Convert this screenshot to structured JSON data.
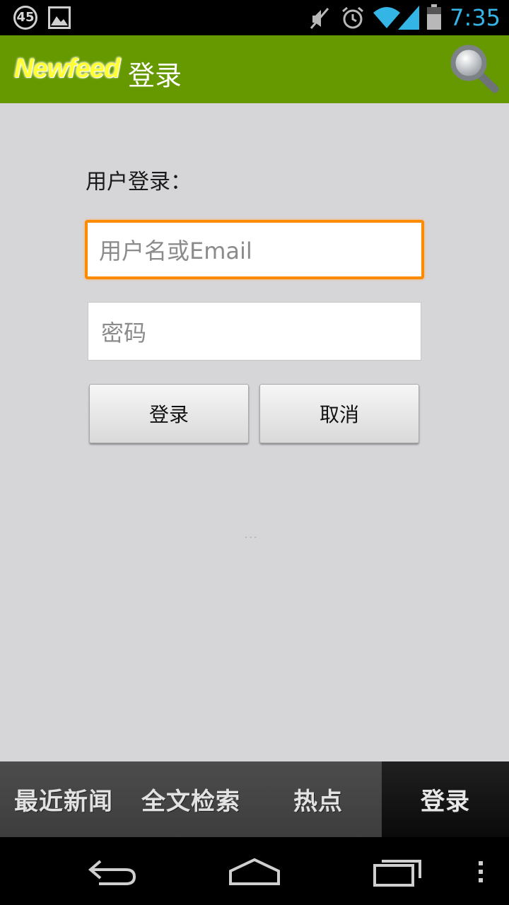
{
  "status_bar": {
    "notification_count": "45",
    "time": "7:35",
    "icons": [
      "notification-badge-icon",
      "photo-icon",
      "muted-icon",
      "alarm-icon",
      "wifi-icon",
      "signal-icon",
      "battery-icon"
    ]
  },
  "action_bar": {
    "brand": "Newfeed",
    "title": "登录",
    "search_icon": "search-icon"
  },
  "login": {
    "label": "用户登录：",
    "username_placeholder": "用户名或Email",
    "password_placeholder": "密码",
    "login_button": "登录",
    "cancel_button": "取消",
    "dots": "..."
  },
  "tabs": [
    {
      "label": "最近新闻"
    },
    {
      "label": "全文检索"
    },
    {
      "label": "热点"
    },
    {
      "label": "登录",
      "active": true
    }
  ],
  "nav_bar": {
    "icons": [
      "back-icon",
      "home-icon",
      "recent-apps-icon",
      "menu-icon"
    ]
  },
  "colors": {
    "action_bar": "#669900",
    "content_bg": "#d6d5d8",
    "focus_border": "#ff8a00",
    "time": "#33b5e5"
  }
}
